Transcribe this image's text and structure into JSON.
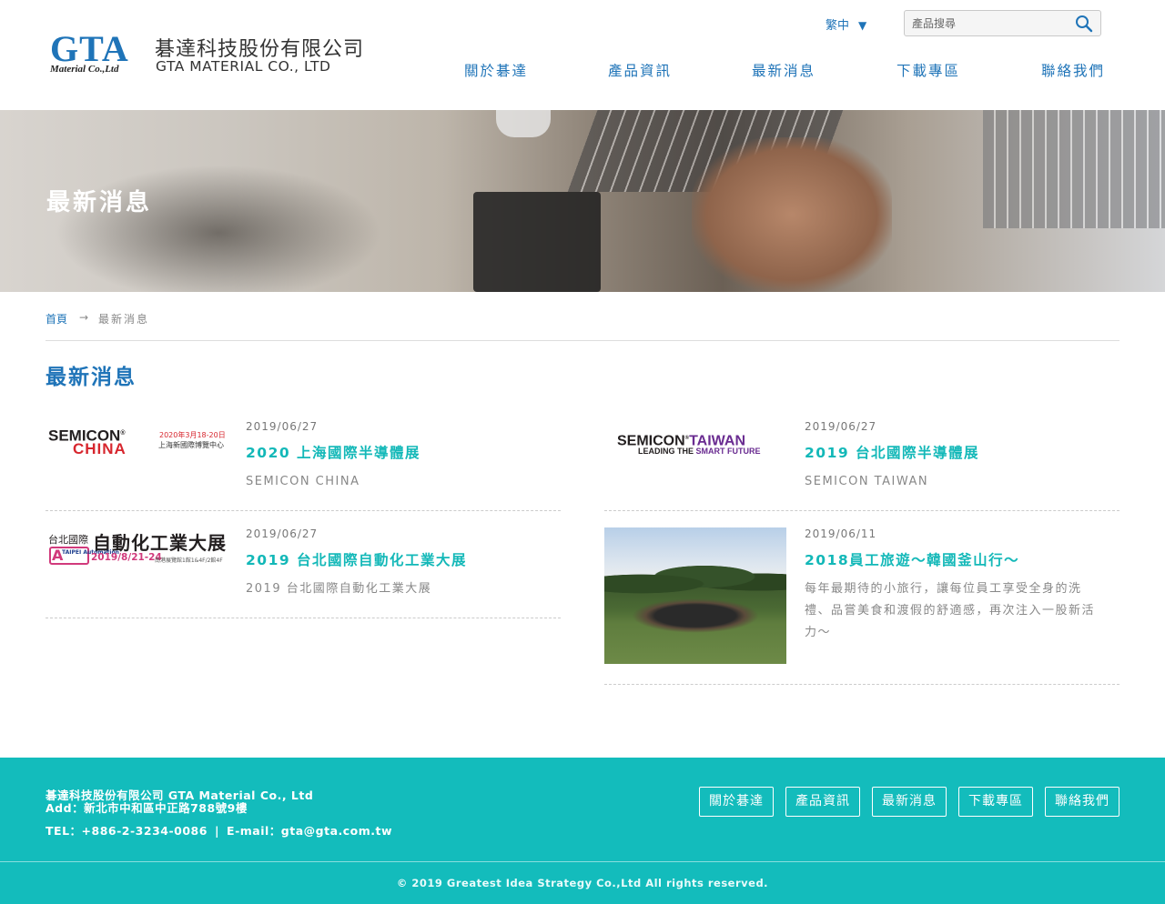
{
  "header": {
    "logo_mark": "GTA",
    "logo_sub": "Material Co.,Ltd",
    "company_zh": "碁達科技股份有限公司",
    "company_en": "GTA MATERIAL CO., LTD",
    "language": "繁中",
    "search_placeholder": "產品搜尋",
    "nav": [
      "關於碁達",
      "產品資訊",
      "最新消息",
      "下載專區",
      "聯絡我們"
    ]
  },
  "banner": {
    "title": "最新消息"
  },
  "breadcrumb": {
    "home": "首頁",
    "arrow": "→",
    "current": "最新消息"
  },
  "section_title": "最新消息",
  "news": [
    {
      "date": "2019/06/27",
      "title": "2020 上海國際半導體展",
      "desc": "SEMICON CHINA",
      "thumb": {
        "line1": "SEMICON",
        "mark": "®",
        "line2": "CHINA",
        "date": "2020年3月18-20日",
        "venue": "上海新國際博覽中心"
      }
    },
    {
      "date": "2019/06/27",
      "title": "2019 台北國際半導體展",
      "desc": "SEMICON TAIWAN",
      "thumb": {
        "line1a": "SEMICON",
        "mark": "®",
        "line1b": "TAIWAN",
        "line2a": "LEADING THE ",
        "line2b": "SMART FUTURE"
      }
    },
    {
      "date": "2019/06/27",
      "title": "2019 台北國際自動化工業大展",
      "desc": "2019 台北國際自動化工業大展",
      "thumb": {
        "small": "台北國際",
        "big": "自動化工業大展",
        "badge_letter": "A",
        "badge_text": "TAIPEI Automation",
        "date": "2019/8/21-24",
        "venue": "南港展覽館1館1&4F/2館4F"
      }
    },
    {
      "date": "2019/06/11",
      "title": "2018員工旅遊～韓國釜山行～",
      "desc": "每年最期待的小旅行，讓每位員工享受全身的洗禮、品嘗美食和渡假的舒適感，再次注入一股新活力～"
    }
  ],
  "footer": {
    "company": "碁達科技股份有限公司 GTA Material Co., Ltd",
    "address": "Add：新北市中和區中正路788號9樓",
    "tel": "TEL：+886-2-3234-0086",
    "sep": "|",
    "email": "E-mail：gta@gta.com.tw",
    "links": [
      "關於碁達",
      "產品資訊",
      "最新消息",
      "下載專區",
      "聯絡我們"
    ],
    "copyright": "© 2019 Greatest Idea Strategy Co.,Ltd All rights reserved."
  },
  "colors": {
    "brand_blue": "#1f74b8",
    "accent_teal": "#13bcbc",
    "news_title": "#13b8b8"
  },
  "icons": {
    "search": "magnifier-icon",
    "language_toggle": "triangle-down-icon",
    "breadcrumb_separator": "arrow-right-icon"
  }
}
